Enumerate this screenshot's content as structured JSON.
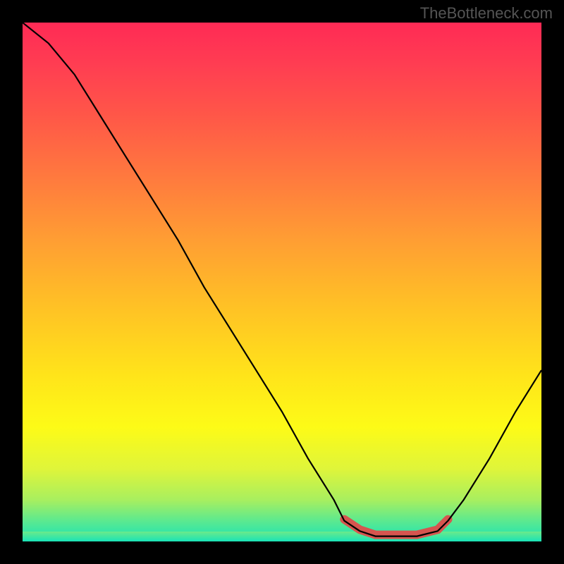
{
  "watermark": "TheBottleneck.com",
  "chart_data": {
    "type": "line",
    "title": "",
    "xlabel": "",
    "ylabel": "",
    "xlim": [
      0,
      100
    ],
    "ylim": [
      0,
      100
    ],
    "grid": false,
    "legend": false,
    "series": [
      {
        "name": "bottleneck-curve",
        "x": [
          0,
          5,
          10,
          15,
          20,
          25,
          30,
          35,
          40,
          45,
          50,
          55,
          60,
          62,
          65,
          68,
          72,
          76,
          80,
          82,
          85,
          90,
          95,
          100
        ],
        "values": [
          100,
          96,
          90,
          82,
          74,
          66,
          58,
          49,
          41,
          33,
          25,
          16,
          8,
          4,
          2,
          1,
          1,
          1,
          2,
          4,
          8,
          16,
          25,
          33
        ]
      }
    ],
    "highlight": {
      "name": "optimal-range",
      "x_start": 62,
      "x_end": 82,
      "y": 1
    },
    "background_gradient": {
      "top_color": "#ff2a55",
      "mid_color": "#ffe41a",
      "bottom_color": "#18e3b8"
    }
  }
}
